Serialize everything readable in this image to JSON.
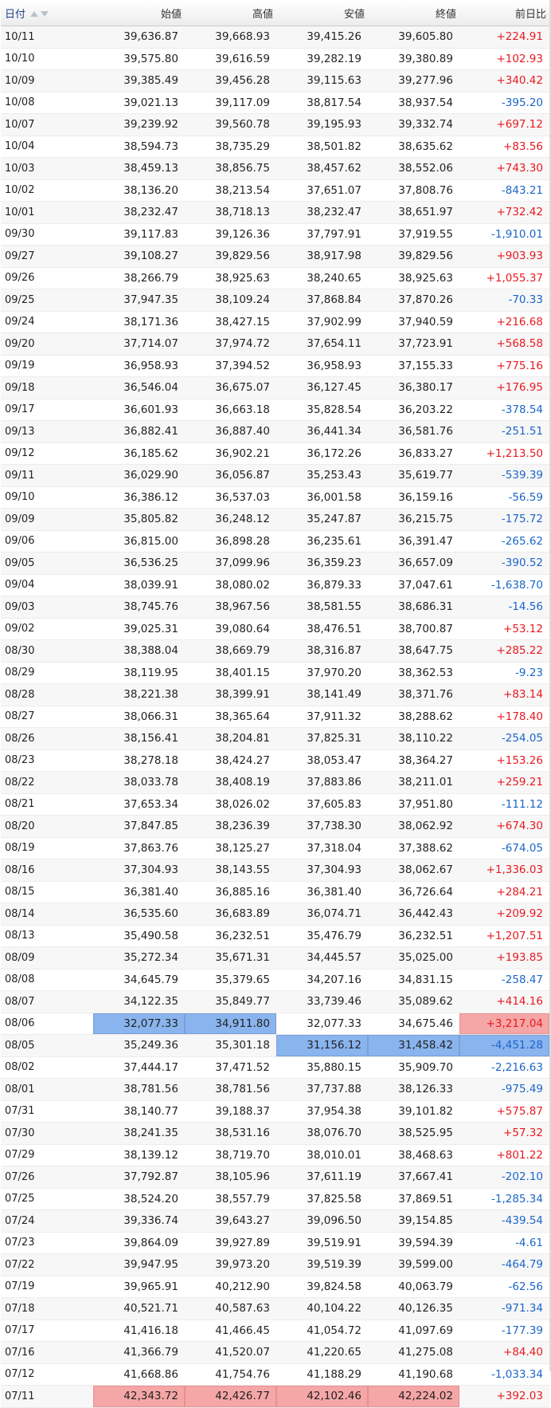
{
  "header": {
    "date": "日付",
    "open": "始値",
    "high": "高値",
    "low": "安値",
    "close": "終値",
    "change": "前日比"
  },
  "colors": {
    "positive": "#e8191f",
    "negative": "#1a66c9",
    "highlight_high": "#f5a6a6",
    "highlight_low": "#8ab4ee"
  },
  "rows": [
    {
      "date": "10/11",
      "open": "39,636.87",
      "high": "39,668.93",
      "low": "39,415.26",
      "close": "39,605.80",
      "change": "+224.91"
    },
    {
      "date": "10/10",
      "open": "39,575.80",
      "high": "39,616.59",
      "low": "39,282.19",
      "close": "39,380.89",
      "change": "+102.93"
    },
    {
      "date": "10/09",
      "open": "39,385.49",
      "high": "39,456.28",
      "low": "39,115.63",
      "close": "39,277.96",
      "change": "+340.42"
    },
    {
      "date": "10/08",
      "open": "39,021.13",
      "high": "39,117.09",
      "low": "38,817.54",
      "close": "38,937.54",
      "change": "-395.20"
    },
    {
      "date": "10/07",
      "open": "39,239.92",
      "high": "39,560.78",
      "low": "39,195.93",
      "close": "39,332.74",
      "change": "+697.12"
    },
    {
      "date": "10/04",
      "open": "38,594.73",
      "high": "38,735.29",
      "low": "38,501.82",
      "close": "38,635.62",
      "change": "+83.56"
    },
    {
      "date": "10/03",
      "open": "38,459.13",
      "high": "38,856.75",
      "low": "38,457.62",
      "close": "38,552.06",
      "change": "+743.30"
    },
    {
      "date": "10/02",
      "open": "38,136.20",
      "high": "38,213.54",
      "low": "37,651.07",
      "close": "37,808.76",
      "change": "-843.21"
    },
    {
      "date": "10/01",
      "open": "38,232.47",
      "high": "38,718.13",
      "low": "38,232.47",
      "close": "38,651.97",
      "change": "+732.42"
    },
    {
      "date": "09/30",
      "open": "39,117.83",
      "high": "39,126.36",
      "low": "37,797.91",
      "close": "37,919.55",
      "change": "-1,910.01"
    },
    {
      "date": "09/27",
      "open": "39,108.27",
      "high": "39,829.56",
      "low": "38,917.98",
      "close": "39,829.56",
      "change": "+903.93"
    },
    {
      "date": "09/26",
      "open": "38,266.79",
      "high": "38,925.63",
      "low": "38,240.65",
      "close": "38,925.63",
      "change": "+1,055.37"
    },
    {
      "date": "09/25",
      "open": "37,947.35",
      "high": "38,109.24",
      "low": "37,868.84",
      "close": "37,870.26",
      "change": "-70.33"
    },
    {
      "date": "09/24",
      "open": "38,171.36",
      "high": "38,427.15",
      "low": "37,902.99",
      "close": "37,940.59",
      "change": "+216.68"
    },
    {
      "date": "09/20",
      "open": "37,714.07",
      "high": "37,974.72",
      "low": "37,654.11",
      "close": "37,723.91",
      "change": "+568.58"
    },
    {
      "date": "09/19",
      "open": "36,958.93",
      "high": "37,394.52",
      "low": "36,958.93",
      "close": "37,155.33",
      "change": "+775.16"
    },
    {
      "date": "09/18",
      "open": "36,546.04",
      "high": "36,675.07",
      "low": "36,127.45",
      "close": "36,380.17",
      "change": "+176.95"
    },
    {
      "date": "09/17",
      "open": "36,601.93",
      "high": "36,663.18",
      "low": "35,828.54",
      "close": "36,203.22",
      "change": "-378.54"
    },
    {
      "date": "09/13",
      "open": "36,882.41",
      "high": "36,887.40",
      "low": "36,441.34",
      "close": "36,581.76",
      "change": "-251.51"
    },
    {
      "date": "09/12",
      "open": "36,185.62",
      "high": "36,902.21",
      "low": "36,172.26",
      "close": "36,833.27",
      "change": "+1,213.50"
    },
    {
      "date": "09/11",
      "open": "36,029.90",
      "high": "36,056.87",
      "low": "35,253.43",
      "close": "35,619.77",
      "change": "-539.39"
    },
    {
      "date": "09/10",
      "open": "36,386.12",
      "high": "36,537.03",
      "low": "36,001.58",
      "close": "36,159.16",
      "change": "-56.59"
    },
    {
      "date": "09/09",
      "open": "35,805.82",
      "high": "36,248.12",
      "low": "35,247.87",
      "close": "36,215.75",
      "change": "-175.72"
    },
    {
      "date": "09/06",
      "open": "36,815.00",
      "high": "36,898.28",
      "low": "36,235.61",
      "close": "36,391.47",
      "change": "-265.62"
    },
    {
      "date": "09/05",
      "open": "36,536.25",
      "high": "37,099.96",
      "low": "36,359.23",
      "close": "36,657.09",
      "change": "-390.52"
    },
    {
      "date": "09/04",
      "open": "38,039.91",
      "high": "38,080.02",
      "low": "36,879.33",
      "close": "37,047.61",
      "change": "-1,638.70"
    },
    {
      "date": "09/03",
      "open": "38,745.76",
      "high": "38,967.56",
      "low": "38,581.55",
      "close": "38,686.31",
      "change": "-14.56"
    },
    {
      "date": "09/02",
      "open": "39,025.31",
      "high": "39,080.64",
      "low": "38,476.51",
      "close": "38,700.87",
      "change": "+53.12"
    },
    {
      "date": "08/30",
      "open": "38,388.04",
      "high": "38,669.79",
      "low": "38,316.87",
      "close": "38,647.75",
      "change": "+285.22"
    },
    {
      "date": "08/29",
      "open": "38,119.95",
      "high": "38,401.15",
      "low": "37,970.20",
      "close": "38,362.53",
      "change": "-9.23"
    },
    {
      "date": "08/28",
      "open": "38,221.38",
      "high": "38,399.91",
      "low": "38,141.49",
      "close": "38,371.76",
      "change": "+83.14"
    },
    {
      "date": "08/27",
      "open": "38,066.31",
      "high": "38,365.64",
      "low": "37,911.32",
      "close": "38,288.62",
      "change": "+178.40"
    },
    {
      "date": "08/26",
      "open": "38,156.41",
      "high": "38,204.81",
      "low": "37,825.31",
      "close": "38,110.22",
      "change": "-254.05"
    },
    {
      "date": "08/23",
      "open": "38,278.18",
      "high": "38,424.27",
      "low": "38,053.47",
      "close": "38,364.27",
      "change": "+153.26"
    },
    {
      "date": "08/22",
      "open": "38,033.78",
      "high": "38,408.19",
      "low": "37,883.86",
      "close": "38,211.01",
      "change": "+259.21"
    },
    {
      "date": "08/21",
      "open": "37,653.34",
      "high": "38,026.02",
      "low": "37,605.83",
      "close": "37,951.80",
      "change": "-111.12"
    },
    {
      "date": "08/20",
      "open": "37,847.85",
      "high": "38,236.39",
      "low": "37,738.30",
      "close": "38,062.92",
      "change": "+674.30"
    },
    {
      "date": "08/19",
      "open": "37,863.76",
      "high": "38,125.27",
      "low": "37,318.04",
      "close": "37,388.62",
      "change": "-674.05"
    },
    {
      "date": "08/16",
      "open": "37,304.93",
      "high": "38,143.55",
      "low": "37,304.93",
      "close": "38,062.67",
      "change": "+1,336.03"
    },
    {
      "date": "08/15",
      "open": "36,381.40",
      "high": "36,885.16",
      "low": "36,381.40",
      "close": "36,726.64",
      "change": "+284.21"
    },
    {
      "date": "08/14",
      "open": "36,535.60",
      "high": "36,683.89",
      "low": "36,074.71",
      "close": "36,442.43",
      "change": "+209.92"
    },
    {
      "date": "08/13",
      "open": "35,490.58",
      "high": "36,232.51",
      "low": "35,476.79",
      "close": "36,232.51",
      "change": "+1,207.51"
    },
    {
      "date": "08/09",
      "open": "35,272.34",
      "high": "35,671.31",
      "low": "34,445.57",
      "close": "35,025.00",
      "change": "+193.85"
    },
    {
      "date": "08/08",
      "open": "34,645.79",
      "high": "35,379.65",
      "low": "34,207.16",
      "close": "34,831.15",
      "change": "-258.47"
    },
    {
      "date": "08/07",
      "open": "34,122.35",
      "high": "35,849.77",
      "low": "33,739.46",
      "close": "35,089.62",
      "change": "+414.16"
    },
    {
      "date": "08/06",
      "open": "32,077.33",
      "high": "34,911.80",
      "low": "32,077.33",
      "close": "34,675.46",
      "change": "+3,217.04",
      "hl": {
        "open": "low",
        "high": "low",
        "change": "high"
      }
    },
    {
      "date": "08/05",
      "open": "35,249.36",
      "high": "35,301.18",
      "low": "31,156.12",
      "close": "31,458.42",
      "change": "-4,451.28",
      "hl": {
        "low": "low",
        "close": "low",
        "change": "low"
      }
    },
    {
      "date": "08/02",
      "open": "37,444.17",
      "high": "37,471.52",
      "low": "35,880.15",
      "close": "35,909.70",
      "change": "-2,216.63"
    },
    {
      "date": "08/01",
      "open": "38,781.56",
      "high": "38,781.56",
      "low": "37,737.88",
      "close": "38,126.33",
      "change": "-975.49"
    },
    {
      "date": "07/31",
      "open": "38,140.77",
      "high": "39,188.37",
      "low": "37,954.38",
      "close": "39,101.82",
      "change": "+575.87"
    },
    {
      "date": "07/30",
      "open": "38,241.35",
      "high": "38,531.16",
      "low": "38,076.70",
      "close": "38,525.95",
      "change": "+57.32"
    },
    {
      "date": "07/29",
      "open": "38,139.12",
      "high": "38,719.70",
      "low": "38,010.01",
      "close": "38,468.63",
      "change": "+801.22"
    },
    {
      "date": "07/26",
      "open": "37,792.87",
      "high": "38,105.96",
      "low": "37,611.19",
      "close": "37,667.41",
      "change": "-202.10"
    },
    {
      "date": "07/25",
      "open": "38,524.20",
      "high": "38,557.79",
      "low": "37,825.58",
      "close": "37,869.51",
      "change": "-1,285.34"
    },
    {
      "date": "07/24",
      "open": "39,336.74",
      "high": "39,643.27",
      "low": "39,096.50",
      "close": "39,154.85",
      "change": "-439.54"
    },
    {
      "date": "07/23",
      "open": "39,864.09",
      "high": "39,927.89",
      "low": "39,519.91",
      "close": "39,594.39",
      "change": "-4.61"
    },
    {
      "date": "07/22",
      "open": "39,947.95",
      "high": "39,973.20",
      "low": "39,519.39",
      "close": "39,599.00",
      "change": "-464.79"
    },
    {
      "date": "07/19",
      "open": "39,965.91",
      "high": "40,212.90",
      "low": "39,824.58",
      "close": "40,063.79",
      "change": "-62.56"
    },
    {
      "date": "07/18",
      "open": "40,521.71",
      "high": "40,587.63",
      "low": "40,104.22",
      "close": "40,126.35",
      "change": "-971.34"
    },
    {
      "date": "07/17",
      "open": "41,416.18",
      "high": "41,466.45",
      "low": "41,054.72",
      "close": "41,097.69",
      "change": "-177.39"
    },
    {
      "date": "07/16",
      "open": "41,366.79",
      "high": "41,520.07",
      "low": "41,220.65",
      "close": "41,275.08",
      "change": "+84.40"
    },
    {
      "date": "07/12",
      "open": "41,668.86",
      "high": "41,754.76",
      "low": "41,188.29",
      "close": "41,190.68",
      "change": "-1,033.34"
    },
    {
      "date": "07/11",
      "open": "42,343.72",
      "high": "42,426.77",
      "low": "42,102.46",
      "close": "42,224.02",
      "change": "+392.03",
      "hl": {
        "open": "high",
        "high": "high",
        "low": "high",
        "close": "high"
      }
    }
  ]
}
